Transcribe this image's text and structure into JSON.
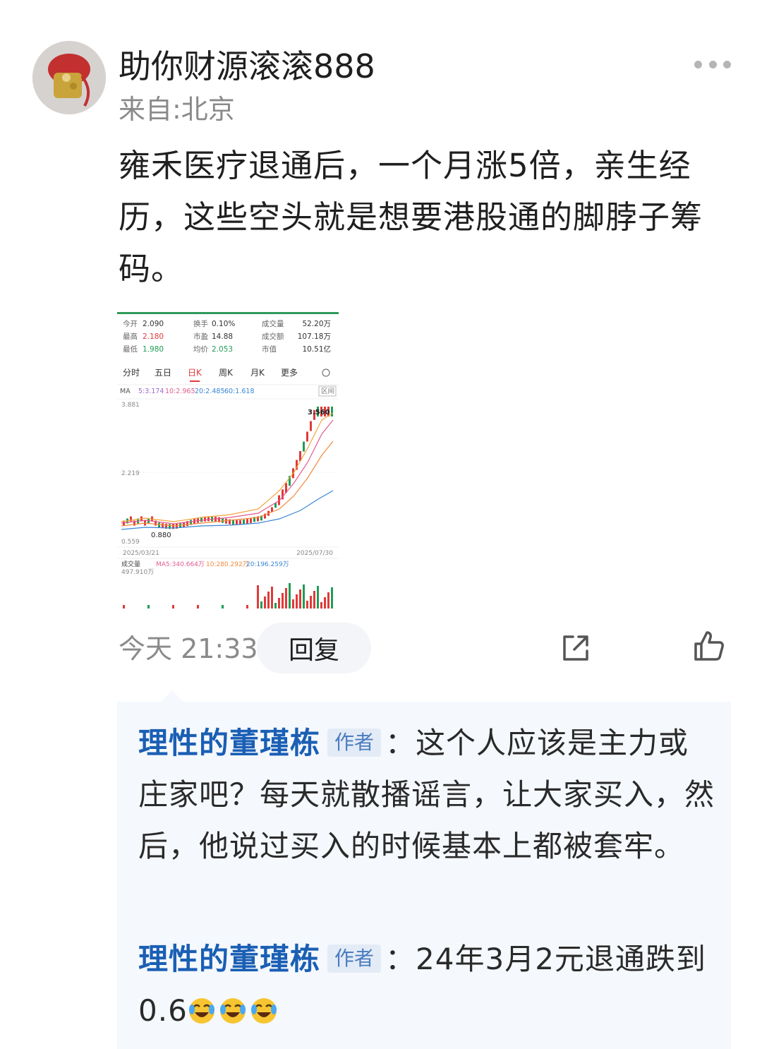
{
  "post": {
    "username": "助你财源滚滚888",
    "location": "来自:北京",
    "text": "雍禾医疗退通后，一个月涨5倍，亲生经历，这些空头就是想要港股通的脚脖子筹码。",
    "time": "今天 21:33",
    "reply_label": "回复",
    "more_icon": "more-dots-icon",
    "share_icon": "share-icon",
    "like_icon": "thumbs-up-icon"
  },
  "stock_image": {
    "stats": [
      {
        "label": "今开",
        "value": "2.090"
      },
      {
        "label": "最高",
        "value": "2.180"
      },
      {
        "label": "最低",
        "value": "1.980"
      },
      {
        "label": "换手",
        "value": "0.10%"
      },
      {
        "label": "市盈",
        "value": "14.88"
      },
      {
        "label": "均价",
        "value": "2.053"
      },
      {
        "label": "成交量",
        "value": "52.20万"
      },
      {
        "label": "成交额",
        "value": "107.18万"
      },
      {
        "label": "市值",
        "value": "10.51亿"
      }
    ],
    "tabs": [
      "分时",
      "五日",
      "日K",
      "周K",
      "月K",
      "更多"
    ],
    "active_tab": "日K",
    "ma_label": "MA",
    "ma_values": [
      "5:3.174",
      "10:2.965",
      "20:2.485",
      "60:1.618"
    ],
    "range_label": "区间",
    "y_max": "3.881",
    "y_mid": "2.219",
    "y_min": "0.559",
    "high_mark": "3.560",
    "low_mark": "0.880",
    "date_start": "2025/03/21",
    "date_end": "2025/07/30",
    "volume_label": "成交量",
    "volume_ma": [
      "MA5:340.664万",
      "10:280.292万",
      "20:196.259万"
    ],
    "volume_max": "497.910万",
    "colors": {
      "up": "#e03a3a",
      "down": "#1f9d55",
      "ma5": "#f2a33a",
      "ma10": "#e25b8f",
      "ma20": "#f08b3e",
      "ma60": "#3a86d6"
    }
  },
  "comments": [
    {
      "author": "理性的董瑾栋",
      "badge": "作者",
      "text": "：这个人应该是主力或庄家吧？每天就散播谣言，让大家买入，然后，他说过买入的时候基本上都被套牢。"
    },
    {
      "author": "理性的董瑾栋",
      "badge": "作者",
      "text": "：24年3月2元退通跌到0.6",
      "emojis": [
        "crying-laughing-emoji",
        "crying-laughing-emoji",
        "crying-laughing-emoji"
      ]
    }
  ]
}
